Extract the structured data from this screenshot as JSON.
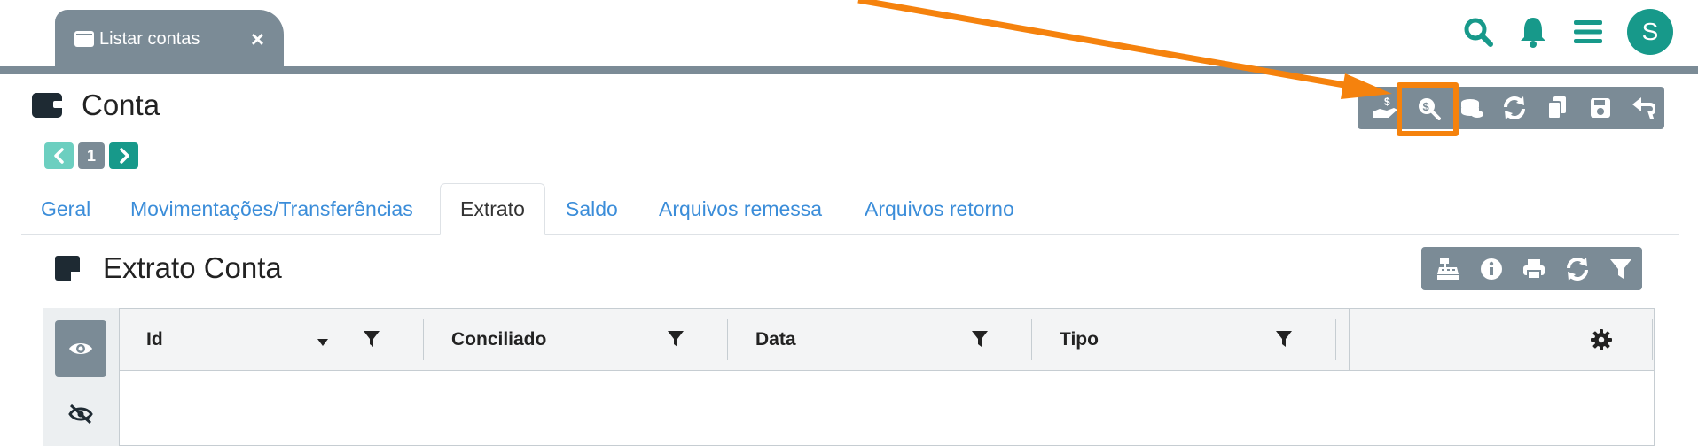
{
  "top_tab": {
    "label": "Listar contas",
    "close": "×"
  },
  "user": {
    "initial": "S"
  },
  "page": {
    "title": "Conta"
  },
  "pager": {
    "current": "1"
  },
  "tabs": [
    {
      "label": "Geral"
    },
    {
      "label": "Movimentações/Transferências"
    },
    {
      "label": "Extrato"
    },
    {
      "label": "Saldo"
    },
    {
      "label": "Arquivos remessa"
    },
    {
      "label": "Arquivos retorno"
    }
  ],
  "active_tab": "Extrato",
  "section": {
    "title": "Extrato Conta"
  },
  "grid": {
    "columns": [
      {
        "label": "Id"
      },
      {
        "label": "Conciliado"
      },
      {
        "label": "Data"
      },
      {
        "label": "Tipo"
      }
    ],
    "rows": []
  },
  "main_toolbar_icons": [
    "hand-dollar-icon",
    "search-dollar-icon",
    "coins-icon",
    "sync-icon",
    "copy-icon",
    "save-icon",
    "undo-icon"
  ],
  "section_toolbar_icons": [
    "cash-register-icon",
    "info-icon",
    "print-icon",
    "sync-icon",
    "filter-icon"
  ],
  "colors": {
    "accent": "#17998a",
    "toolbar": "#7b8b96",
    "highlight": "#f5820d",
    "link": "#3b8dd9"
  }
}
